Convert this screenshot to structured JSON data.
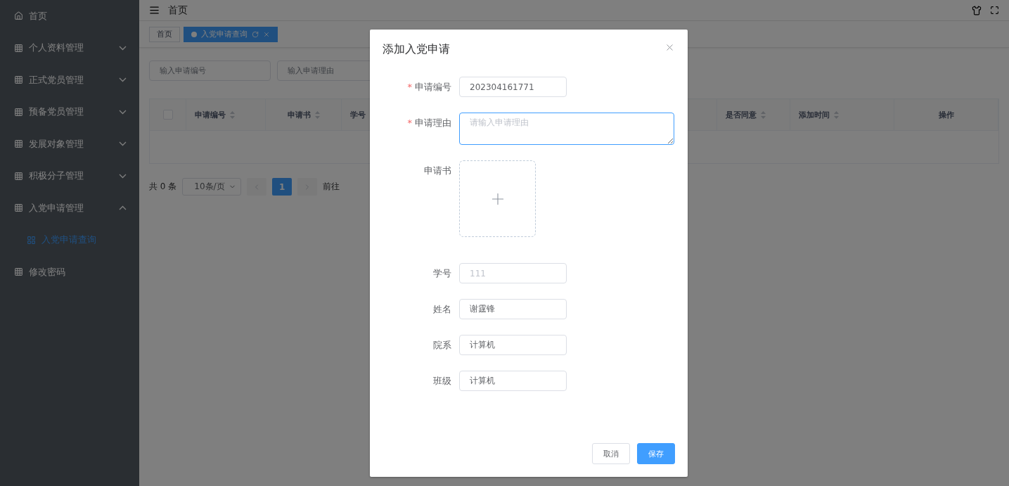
{
  "sidebar": {
    "items": [
      {
        "label": "首页",
        "kind": "link"
      },
      {
        "label": "个人资料管理",
        "kind": "group",
        "expanded": false
      },
      {
        "label": "正式党员管理",
        "kind": "group",
        "expanded": false
      },
      {
        "label": "预备党员管理",
        "kind": "group",
        "expanded": false
      },
      {
        "label": "发展对象管理",
        "kind": "group",
        "expanded": false
      },
      {
        "label": "积极分子管理",
        "kind": "group",
        "expanded": false
      },
      {
        "label": "入党申请管理",
        "kind": "group",
        "expanded": true,
        "children": [
          {
            "label": "入党申请查询",
            "selected": true
          }
        ]
      },
      {
        "label": "修改密码",
        "kind": "link"
      }
    ]
  },
  "header": {
    "breadcrumb": "首页"
  },
  "tabs": [
    {
      "label": "首页",
      "selected": false
    },
    {
      "label": "入党申请查询",
      "selected": true
    }
  ],
  "search": [
    {
      "placeholder": "输入申请编号"
    },
    {
      "placeholder": "输入申请理由"
    }
  ],
  "table": {
    "columns_left": [
      {
        "label": "申请编号",
        "sortable": true
      },
      {
        "label": "申请书",
        "sortable": true
      },
      {
        "label": "学号"
      }
    ],
    "columns_right": [
      {
        "label": "是否同意",
        "sortable": true
      },
      {
        "label": "添加时间",
        "sortable": true
      },
      {
        "label": "操作",
        "sortable": false
      }
    ],
    "select_all": false
  },
  "pagination": {
    "total": "共 0 条",
    "page_size": "10条/页",
    "pages": [
      {
        "label": "1",
        "selected": true
      }
    ],
    "goto": "前往"
  },
  "dialog": {
    "title": "添加入党申请",
    "fields": [
      {
        "kind": "input",
        "label": "申请编号",
        "required_mark": "*",
        "value": "202304161771"
      },
      {
        "kind": "textarea",
        "label": "申请理由",
        "required_mark": "*",
        "placeholder": "请输入申请理由",
        "focused": true
      },
      {
        "kind": "upload",
        "label": "申请书"
      },
      {
        "kind": "input",
        "label": "学号",
        "placeholder": "111"
      },
      {
        "kind": "input",
        "label": "姓名",
        "value": "谢霆锋"
      },
      {
        "kind": "input",
        "label": "院系",
        "value": "计算机"
      },
      {
        "kind": "input",
        "label": "班级",
        "value": "计算机"
      }
    ],
    "buttons": [
      {
        "label": "取消",
        "kind": "default"
      },
      {
        "label": "保存",
        "kind": "primary"
      }
    ]
  }
}
